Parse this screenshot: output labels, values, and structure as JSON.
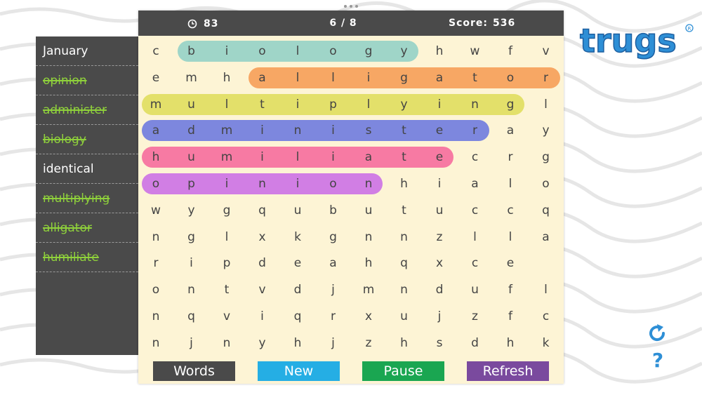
{
  "logo_text": "trugs",
  "topbar": {
    "time": "83",
    "progress": "6 / 8",
    "score_label": "Score:",
    "score_value": "536"
  },
  "words": [
    {
      "label": "January",
      "found": false
    },
    {
      "label": "opinion",
      "found": true
    },
    {
      "label": "administer",
      "found": true
    },
    {
      "label": "biology",
      "found": true
    },
    {
      "label": "identical",
      "found": false
    },
    {
      "label": "multiplying",
      "found": true
    },
    {
      "label": "alligator",
      "found": true
    },
    {
      "label": "humiliate",
      "found": true
    }
  ],
  "grid": [
    "cbiologyhwfv",
    "emhalligator",
    "multiplyingl",
    "administeray",
    "humiliatecrg",
    "opinionhialo",
    "wygqubutuccq",
    "nglxkgnnzlla",
    "ripdeahqxce",
    "ontvdjmndufl",
    "nqviqrxujzfc",
    "njnyhjzhsdhk"
  ],
  "highlights": [
    {
      "word": "biology",
      "color": "#9fd5c8"
    },
    {
      "word": "alligator",
      "color": "#f7a764"
    },
    {
      "word": "multiplying",
      "color": "#e3e06a"
    },
    {
      "word": "administer",
      "color": "#7d87de"
    },
    {
      "word": "humiliate",
      "color": "#f77aa3"
    },
    {
      "word": "opinion",
      "color": "#d17ee4"
    }
  ],
  "buttons": [
    {
      "label": "Words",
      "color": "#4a4a4a"
    },
    {
      "label": "New",
      "color": "#25aee4"
    },
    {
      "label": "Pause",
      "color": "#1aa651"
    },
    {
      "label": "Refresh",
      "color": "#7a4a9e"
    }
  ],
  "icons": {
    "timer": "clock-icon",
    "refresh": "refresh-icon",
    "help": "help-icon"
  },
  "accent_color": "#2e8fd6"
}
